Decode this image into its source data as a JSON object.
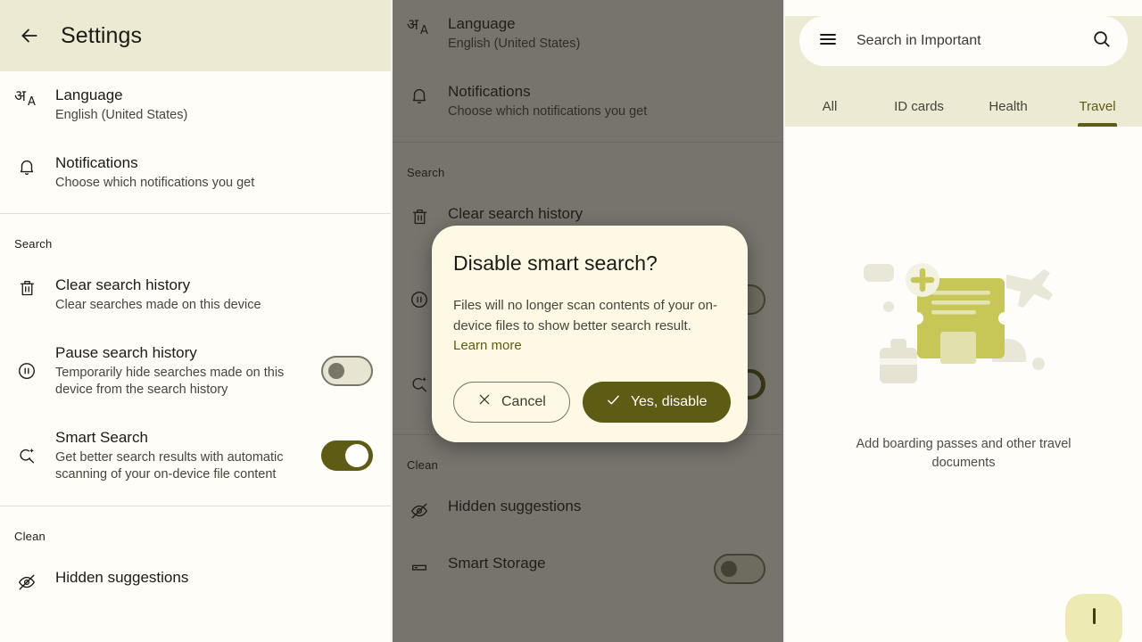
{
  "theme": {
    "header_bg": "#edead3",
    "surface": "#fffdf7",
    "accent": "#5e5b14",
    "dialog_bg": "#fdf9e4",
    "toggle_on": "#5e5b14",
    "toggle_off_track": "#e7e4d2",
    "scrim": "rgba(35,33,25,0.62)",
    "text_primary": "#1b1b17",
    "text_secondary": "#46463c"
  },
  "settings": {
    "appbar": {
      "back_icon": "arrow-left-icon",
      "title": "Settings"
    },
    "groups": [
      {
        "header": null,
        "rows": [
          {
            "icon": "translate-icon",
            "title": "Language",
            "subtitle": "English (United States)",
            "control": "none"
          },
          {
            "icon": "bell-icon",
            "title": "Notifications",
            "subtitle": "Choose which notifications you get",
            "control": "none"
          }
        ]
      },
      {
        "header": "Search",
        "rows": [
          {
            "icon": "trash-icon",
            "title": "Clear search history",
            "subtitle": "Clear searches made on this device",
            "control": "none"
          },
          {
            "icon": "pause-circle-icon",
            "title": "Pause search history",
            "subtitle": "Temporarily hide searches made on this device from the search history",
            "control": "toggle",
            "toggle_state": "off"
          },
          {
            "icon": "smart-search-icon",
            "title": "Smart Search",
            "subtitle": "Get better search results with automatic scanning of your on-device file content",
            "control": "toggle",
            "toggle_state": "on"
          }
        ]
      },
      {
        "header": "Clean",
        "rows": [
          {
            "icon": "eye-off-icon",
            "title": "Hidden suggestions",
            "subtitle": "",
            "control": "none"
          },
          {
            "icon": "storage-icon",
            "title": "Smart Storage",
            "subtitle": "",
            "control": "toggle",
            "toggle_state": "off"
          }
        ]
      }
    ]
  },
  "dialog": {
    "title": "Disable smart search?",
    "body_text": "Files will no longer scan contents of your on-device files to show better search result.",
    "link_text": "Learn more",
    "cancel": {
      "label": "Cancel",
      "icon": "close-icon"
    },
    "confirm": {
      "label": "Yes, disable",
      "icon": "check-icon"
    }
  },
  "important": {
    "search": {
      "menu_icon": "hamburger-menu-icon",
      "placeholder": "Search in Important",
      "search_icon": "search-icon"
    },
    "tabs": [
      {
        "label": "All",
        "active": false
      },
      {
        "label": "ID cards",
        "active": false
      },
      {
        "label": "Health",
        "active": false
      },
      {
        "label": "Travel",
        "active": true
      }
    ],
    "empty_state": {
      "illustration": "boarding-pass-illustration",
      "caption": "Add boarding passes and other travel documents"
    },
    "fab": {
      "icon": "add-icon"
    }
  }
}
